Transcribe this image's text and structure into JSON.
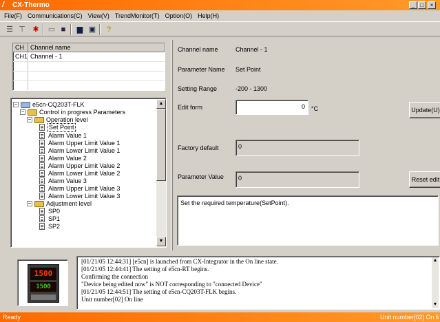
{
  "window": {
    "title": "CX-Thermo",
    "controls": [
      "minimize-icon",
      "maximize-icon",
      "close-icon"
    ]
  },
  "menu": [
    "File(F)",
    "Communications(C)",
    "View(V)",
    "TrendMonitor(T)",
    "Option(O)",
    "Help(H)"
  ],
  "toolbar": {
    "icons": [
      "settings-icon",
      "filter-icon",
      "pin-icon",
      "open-icon",
      "save-icon",
      "monitor-icon",
      "window-icon",
      "help-icon"
    ]
  },
  "channel_table": {
    "headers": [
      "CH",
      "Channel name"
    ],
    "rows": [
      {
        "ch": "CH1",
        "name": "Channel - 1"
      }
    ]
  },
  "tree": {
    "root": "e5cn-CQ203T-FLK",
    "control_group": "Control in progress Parameters",
    "operation_level": "Operation level",
    "operation_items": [
      "Set Point",
      "Alarm Value 1",
      "Alarm Upper Limit Value 1",
      "Alarm Lower Limit Value 1",
      "Alarm Value 2",
      "Alarm Upper Limit Value 2",
      "Alarm Lower Limit Value 2",
      "Alarm Value 3",
      "Alarm Upper Limit Value 3",
      "Alarm Lower Limit Value 3"
    ],
    "adjustment_level": "Adjustment level",
    "adjustment_items": [
      "SP0",
      "SP1",
      "SP2"
    ]
  },
  "detail": {
    "channel_name_label": "Channel name",
    "channel_name_value": "Channel - 1",
    "parameter_name_label": "Parameter Name",
    "parameter_name_value": "Set Point",
    "setting_range_label": "Setting Range",
    "setting_range_value": "-200 - 1300",
    "edit_form_label": "Edit form",
    "edit_form_value": "0",
    "unit": "°C",
    "update_button": "Update(U)",
    "factory_default_label": "Factory default",
    "factory_default_value": "0",
    "parameter_value_label": "Parameter Value",
    "parameter_value_value": "0",
    "reset_button": "Reset edit",
    "description": "Set the required temperature(SetPoint)."
  },
  "log": {
    "lines": [
      "[01/21/05 12:44:31] [e5cn] is launched from CX-Integrator in the On line state.",
      "[01/21/05 12:44:41] The setting of e5cn-RT begins.",
      "Confirming the connection",
      "\"Device being edited now\" is NOT corresponding to \"connected Device\"",
      "[01/21/05 12:44:51] The setting of e5cn-CQ203T-FLK begins.",
      "Unit number[02]  On line"
    ],
    "device_display_top": "1500",
    "device_display_bottom": "1500"
  },
  "status": {
    "left": "Ready",
    "right": "Unit number[02]  On li"
  },
  "colors": {
    "titlebar": "#ff6a00",
    "statusbar": "#ff6a00",
    "face": "#d4d0c8"
  }
}
